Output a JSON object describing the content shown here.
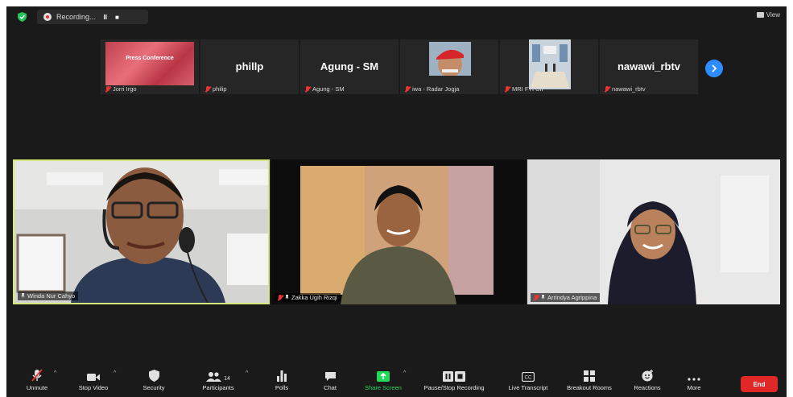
{
  "topbar": {
    "recording_text": "Recording...",
    "pause_label": "II",
    "stop_label": "■",
    "view_label": "View"
  },
  "thumbnails": [
    {
      "name": "Jorri Irgo",
      "display": "slide",
      "slide_title": "Press Conference"
    },
    {
      "name": "philip",
      "display": "name",
      "center_name": "phillp"
    },
    {
      "name": "Agung - SM",
      "display": "name",
      "center_name": "Agung - SM"
    },
    {
      "name": "iwa - Radar Jogja",
      "display": "face"
    },
    {
      "name": "MRI FTI UII",
      "display": "room"
    },
    {
      "name": "nawawi_rbtv",
      "display": "name",
      "center_name": "nawawi_rbtv"
    }
  ],
  "videos": [
    {
      "name": "Winda Nur Cahyo",
      "active_speaker": true
    },
    {
      "name": "Zakka Ugih Rizqi",
      "active_speaker": false
    },
    {
      "name": "Arrindya Agrippina",
      "active_speaker": false
    }
  ],
  "toolbar": {
    "unmute": "Unmute",
    "stop_video": "Stop Video",
    "security": "Security",
    "participants": "Participants",
    "participant_count": "14",
    "polls": "Polls",
    "chat": "Chat",
    "share_screen": "Share Screen",
    "pause_recording": "Pause/Stop Recording",
    "live_transcript": "Live Transcript",
    "breakout_rooms": "Breakout Rooms",
    "reactions": "Reactions",
    "more": "More",
    "end": "End"
  },
  "colors": {
    "background": "#1a1a1a",
    "active_speaker_border": "#d7e77a",
    "share_green": "#23d959",
    "end_red": "#e02828",
    "accent_blue": "#2d8cff"
  }
}
